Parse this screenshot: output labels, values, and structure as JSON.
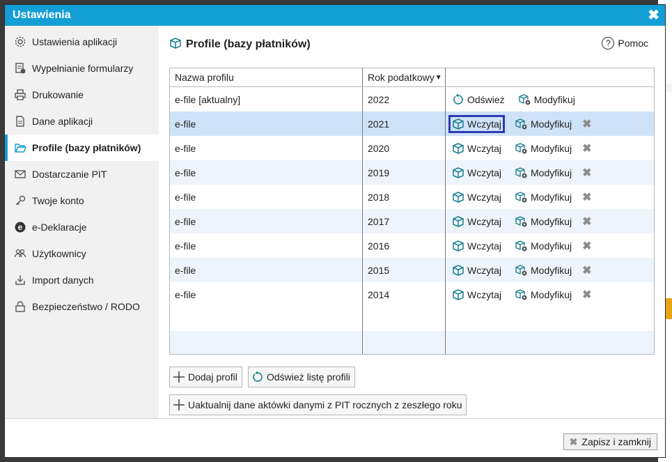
{
  "window": {
    "title": "Ustawienia"
  },
  "sidebar": {
    "items": [
      {
        "label": "Ustawienia aplikacji",
        "icon": "gear-icon"
      },
      {
        "label": "Wypełnianie formularzy",
        "icon": "form-fill-icon"
      },
      {
        "label": "Drukowanie",
        "icon": "printer-icon"
      },
      {
        "label": "Dane aplikacji",
        "icon": "document-icon"
      },
      {
        "label": "Profile (bazy płatników)",
        "icon": "folder-open-icon",
        "active": true
      },
      {
        "label": "Dostarczanie PIT",
        "icon": "envelope-icon"
      },
      {
        "label": "Twoje konto",
        "icon": "key-icon"
      },
      {
        "label": "e-Deklaracje",
        "icon": "e-icon"
      },
      {
        "label": "Użytkownicy",
        "icon": "users-icon"
      },
      {
        "label": "Import danych",
        "icon": "import-icon"
      },
      {
        "label": "Bezpieczeństwo / RODO",
        "icon": "lock-icon"
      }
    ]
  },
  "main": {
    "title": "Profile (bazy płatników)",
    "help_label": "Pomoc",
    "columns": {
      "name": "Nazwa profilu",
      "year": "Rok podatkowy"
    },
    "actions": {
      "refresh": "Odśwież",
      "load": "Wczytaj",
      "modify": "Modyfikuj"
    },
    "rows": [
      {
        "name": "e-file [aktualny]",
        "year": "2022"
      },
      {
        "name": "e-file",
        "year": "2021"
      },
      {
        "name": "e-file",
        "year": "2020"
      },
      {
        "name": "e-file",
        "year": "2019"
      },
      {
        "name": "e-file",
        "year": "2018"
      },
      {
        "name": "e-file",
        "year": "2017"
      },
      {
        "name": "e-file",
        "year": "2016"
      },
      {
        "name": "e-file",
        "year": "2015"
      },
      {
        "name": "e-file",
        "year": "2014"
      }
    ],
    "add_profile_label": "Dodaj profil",
    "refresh_list_label": "Odśwież listę profili",
    "update_label": "Uaktualnij dane aktówki danymi z PIT rocznych z zeszłego roku"
  },
  "footer": {
    "save_close_label": "Zapisz i zamknij"
  },
  "colors": {
    "title_bar": "#149ed6",
    "selected_row": "#cfe3f8",
    "focus_border": "#2c3bb5",
    "icon_teal": "#1a7f8e"
  }
}
